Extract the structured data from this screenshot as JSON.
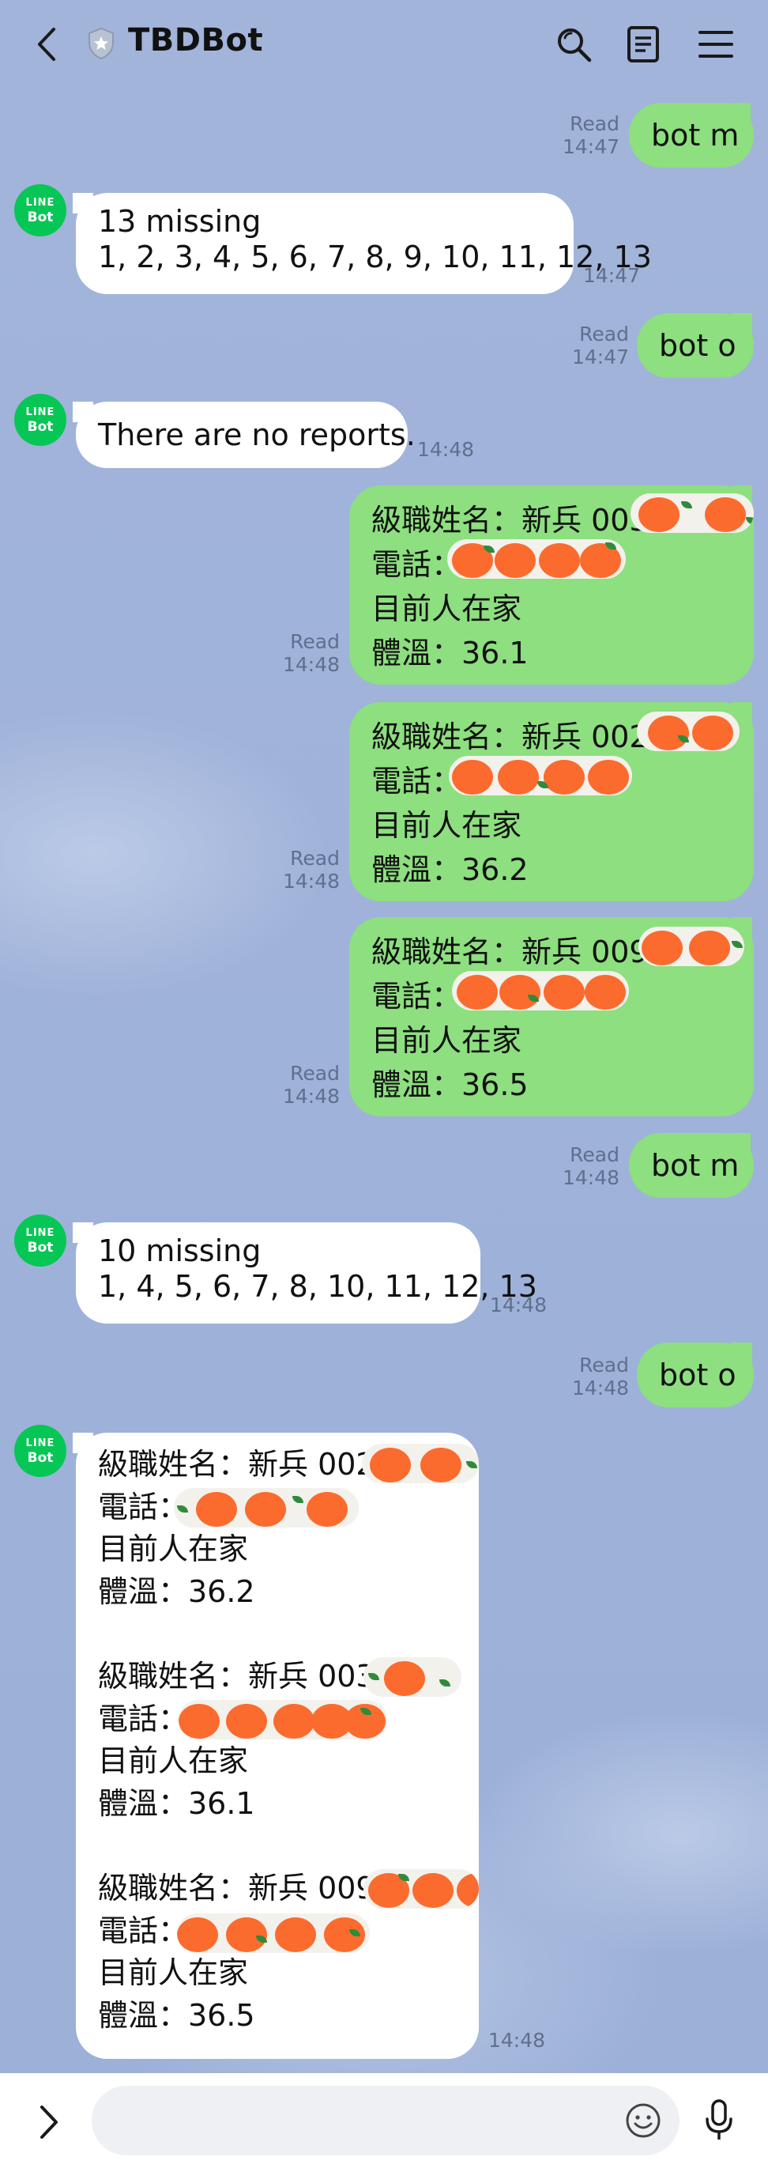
{
  "header": {
    "title": "TBDBot",
    "back_icon": "chevron-left-icon",
    "shield_icon": "shield-star-icon",
    "search_icon": "search-icon",
    "notes_icon": "notes-icon",
    "menu_icon": "hamburger-menu-icon"
  },
  "avatar": {
    "line1": "LINE",
    "line2": "Bot"
  },
  "messages": [
    {
      "from": "me",
      "lines": [
        "bot m"
      ],
      "read": "Read",
      "time": "14:47"
    },
    {
      "from": "bot",
      "lines": [
        "13 missing",
        "1, 2, 3, 4, 5, 6, 7, 8, 9, 10, 11, 12, 13"
      ],
      "time": "14:47"
    },
    {
      "from": "me",
      "lines": [
        "bot o"
      ],
      "read": "Read",
      "time": "14:47"
    },
    {
      "from": "bot",
      "lines": [
        "There are no reports."
      ],
      "time": "14:48"
    },
    {
      "from": "me",
      "lines": [
        "級職姓名：新兵 003",
        "電話：",
        "目前人在家",
        "體溫：36.1"
      ],
      "read": "Read",
      "time": "14:48"
    },
    {
      "from": "me",
      "lines": [
        "級職姓名：新兵 002",
        "電話：",
        "目前人在家",
        "體溫：36.2"
      ],
      "read": "Read",
      "time": "14:48"
    },
    {
      "from": "me",
      "lines": [
        "級職姓名：新兵 009",
        "電話：",
        "目前人在家",
        "體溫：36.5"
      ],
      "read": "Read",
      "time": "14:48"
    },
    {
      "from": "me",
      "lines": [
        "bot m"
      ],
      "read": "Read",
      "time": "14:48"
    },
    {
      "from": "bot",
      "lines": [
        "10 missing",
        "1, 4, 5, 6, 7, 8, 10, 11, 12, 13"
      ],
      "time": "14:48"
    },
    {
      "from": "me",
      "lines": [
        "bot o"
      ],
      "read": "Read",
      "time": "14:48"
    },
    {
      "from": "bot",
      "lines": [
        "級職姓名：新兵 002",
        "電話：",
        "目前人在家",
        "體溫：36.2",
        "",
        "級職姓名：新兵 003",
        "電話：",
        "目前人在家",
        "體溫：36.1",
        "",
        "級職姓名：新兵 009",
        "電話：",
        "目前人在家",
        "體溫：36.5"
      ],
      "time": "14:48"
    }
  ],
  "input_bar": {
    "expand_icon": "chevron-right-icon",
    "emoji_icon": "smiley-icon",
    "mic_icon": "microphone-icon",
    "placeholder": ""
  },
  "colors": {
    "background": "#9bb0d8",
    "outgoing_bubble": "#8ddf7f",
    "incoming_bubble": "#ffffff",
    "avatar": "#06c755",
    "redaction_orange": "#fb6b2e"
  }
}
